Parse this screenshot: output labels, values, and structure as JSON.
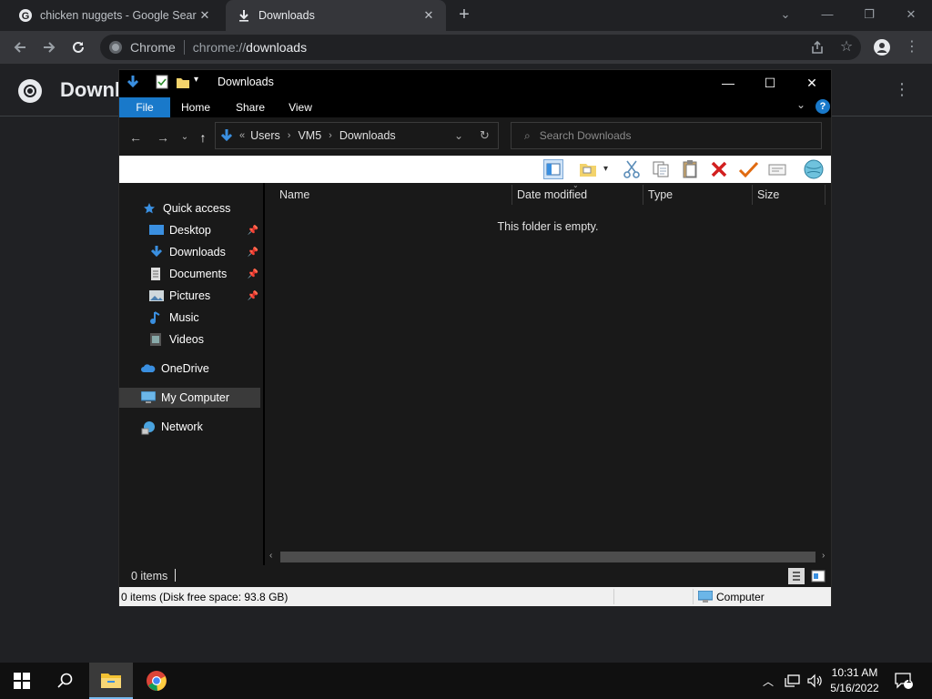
{
  "chrome": {
    "tabs": [
      {
        "title": "chicken nuggets - Google Search",
        "icon": "google-g-icon",
        "active": false
      },
      {
        "title": "Downloads",
        "icon": "download-icon",
        "active": true
      }
    ],
    "new_tab": "+",
    "window_controls": {
      "tab_search": "⌄",
      "minimize": "—",
      "restore": "❐",
      "close": "✕"
    },
    "omnibox": {
      "site_name": "Chrome",
      "url_scheme": "chrome://",
      "url_host": "downloads"
    },
    "page": {
      "title": "Downl"
    }
  },
  "explorer": {
    "title": "Downloads",
    "ribbon_tabs": [
      "File",
      "Home",
      "Share",
      "View"
    ],
    "help": "?",
    "breadcrumb": [
      "Users",
      "VM5",
      "Downloads"
    ],
    "breadcrumb_overflow": "«",
    "search_placeholder": "Search Downloads",
    "nav_pane": {
      "quick_access": "Quick access",
      "quick_items": [
        {
          "label": "Desktop",
          "icon": "desktop-icon",
          "pinned": true
        },
        {
          "label": "Downloads",
          "icon": "downloads-folder-icon",
          "pinned": true
        },
        {
          "label": "Documents",
          "icon": "documents-icon",
          "pinned": true
        },
        {
          "label": "Pictures",
          "icon": "pictures-icon",
          "pinned": true
        },
        {
          "label": "Music",
          "icon": "music-icon",
          "pinned": false
        },
        {
          "label": "Videos",
          "icon": "videos-icon",
          "pinned": false
        }
      ],
      "onedrive": "OneDrive",
      "my_computer": "My Computer",
      "network": "Network"
    },
    "columns": [
      "Name",
      "Date modified",
      "Type",
      "Size"
    ],
    "empty_message": "This folder is empty.",
    "status": {
      "item_count": "0 items",
      "details": "0 items (Disk free space: 93.8 GB)",
      "location": "Computer"
    }
  },
  "taskbar": {
    "time": "10:31 AM",
    "date": "5/16/2022",
    "notification_count": "1"
  },
  "colors": {
    "accent": "#1979ca",
    "chrome_bg": "#202124",
    "explorer_bg": "#191919"
  }
}
